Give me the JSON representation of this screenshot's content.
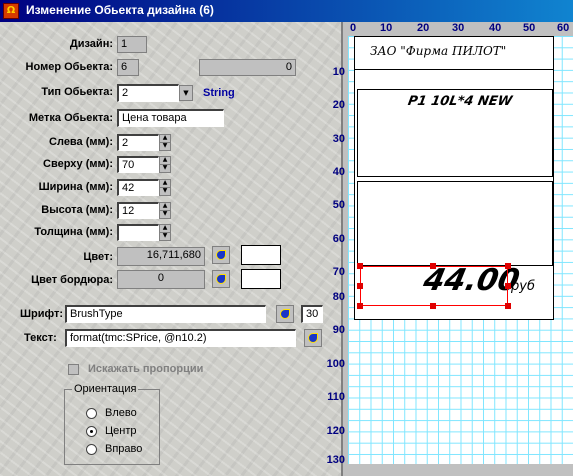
{
  "window": {
    "title": "Изменение Обьекта дизайна  (6)",
    "icon_text": "Ω"
  },
  "form": {
    "design_label": "Дизайн:",
    "design_value": "1",
    "object_no_label": "Номер Обьекта:",
    "object_no_value": "6",
    "object_extra_value": "0",
    "type_label": "Тип Обьекта:",
    "type_value": "2",
    "type_name": "String",
    "tag_label": "Метка Обьекта:",
    "tag_value": "Цена товара",
    "left_label": "Слева (мм):",
    "left_value": "2",
    "top_label": "Сверху (мм):",
    "top_value": "70",
    "width_label": "Ширина (мм):",
    "width_value": "42",
    "height_label": "Высота (мм):",
    "height_value": "12",
    "thickness_label": "Толщина (мм):",
    "thickness_value": "",
    "color_label": "Цвет:",
    "color_value": "16,711,680",
    "border_color_label": "Цвет бордюра:",
    "border_color_value": "0",
    "font_label": "Шрифт:",
    "font_value": "BrushType",
    "font_size": "30",
    "text_label": "Текст:",
    "text_value": "format(tmc:SPrice, @n10.2)",
    "distort_label": "Искажать пропорции",
    "orientation": {
      "legend": "Ориентация",
      "options": [
        {
          "label": "Влево",
          "selected": false
        },
        {
          "label": "Центр",
          "selected": true
        },
        {
          "label": "Вправо",
          "selected": false
        }
      ]
    }
  },
  "preview": {
    "ruler_top": [
      "0",
      "10",
      "20",
      "30",
      "40",
      "50",
      "60"
    ],
    "ruler_left": [
      "10",
      "20",
      "30",
      "40",
      "50",
      "60",
      "70",
      "80",
      "90",
      "100",
      "110",
      "120",
      "130"
    ],
    "header_text": "ЗАО \"Фирма ПИЛОТ\"",
    "product_text": "P1 10L*4 NEW",
    "price_text": "44.00",
    "currency_text": "руб",
    "grid_color": "#7fe6ff",
    "selection_color": "#ff0000"
  }
}
